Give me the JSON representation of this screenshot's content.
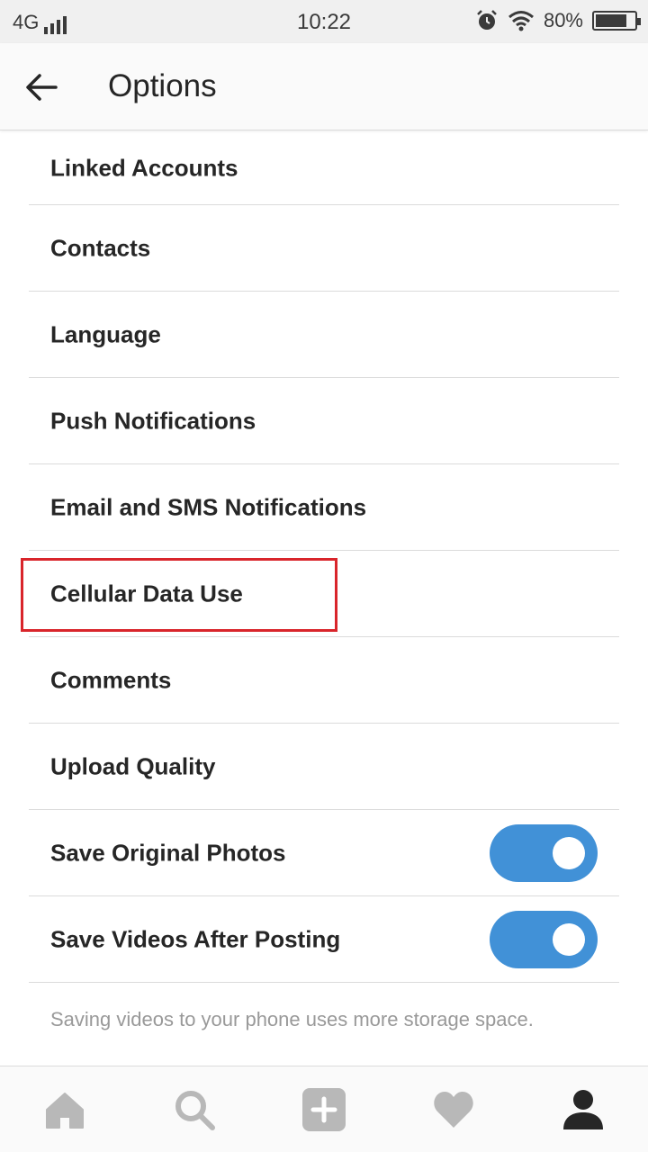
{
  "status_bar": {
    "network": "4G",
    "time": "10:22",
    "battery_text": "80%",
    "battery_level": 0.8,
    "icons": [
      "signal-icon",
      "alarm-icon",
      "wifi-icon",
      "battery-icon"
    ]
  },
  "header": {
    "title": "Options",
    "back_icon": "arrow-left-icon"
  },
  "options": {
    "items": [
      {
        "label": "Linked Accounts"
      },
      {
        "label": "Contacts"
      },
      {
        "label": "Language"
      },
      {
        "label": "Push Notifications"
      },
      {
        "label": "Email and SMS Notifications"
      },
      {
        "label": "Cellular Data Use"
      },
      {
        "label": "Comments"
      },
      {
        "label": "Upload Quality"
      },
      {
        "label": "Save Original Photos",
        "toggle_on": true
      },
      {
        "label": "Save Videos After Posting",
        "toggle_on": true
      }
    ],
    "footnote": "Saving videos to your phone uses more storage space.",
    "highlight_color": "#d9252b",
    "toggle_color": "#4191d7"
  },
  "tab_bar": {
    "tabs": [
      "home-icon",
      "search-icon",
      "add-post-icon",
      "activity-heart-icon",
      "profile-icon"
    ],
    "active_tab": "profile-icon"
  }
}
